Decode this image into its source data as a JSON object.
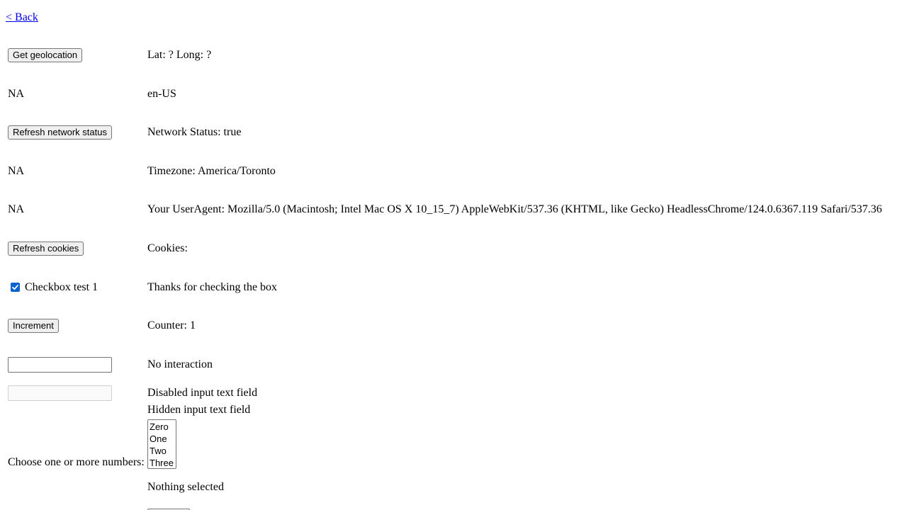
{
  "nav": {
    "back_label": "< Back"
  },
  "rows": {
    "geolocation": {
      "button": "Get geolocation",
      "result": "Lat: ? Long: ?"
    },
    "language": {
      "left": "NA",
      "result": "en-US"
    },
    "network": {
      "button": "Refresh network status",
      "result": "Network Status: true"
    },
    "timezone": {
      "left": "NA",
      "result": "Timezone: America/Toronto"
    },
    "useragent": {
      "left": "NA",
      "result": "Your UserAgent: Mozilla/5.0 (Macintosh; Intel Mac OS X 10_15_7) AppleWebKit/537.36 (KHTML, like Gecko) HeadlessChrome/124.0.6367.119 Safari/537.36"
    },
    "cookies": {
      "button": "Refresh cookies",
      "result": "Cookies:"
    },
    "checkbox": {
      "label": "Checkbox test 1",
      "checked": true,
      "result": "Thanks for checking the box"
    },
    "counter": {
      "button": "Increment",
      "result": "Counter: 1"
    },
    "text_input": {
      "value": "",
      "result": "No interaction"
    },
    "disabled_input": {
      "value": "",
      "result": "Disabled input text field"
    },
    "hidden_input": {
      "result": "Hidden input text field"
    },
    "multi_select": {
      "label": "Choose one or more numbers:",
      "options": [
        "Zero",
        "One",
        "Two",
        "Three"
      ],
      "result": "Nothing selected"
    }
  },
  "colors": {
    "link": "#0000ee",
    "checkbox_accent": "#0b63ce"
  }
}
